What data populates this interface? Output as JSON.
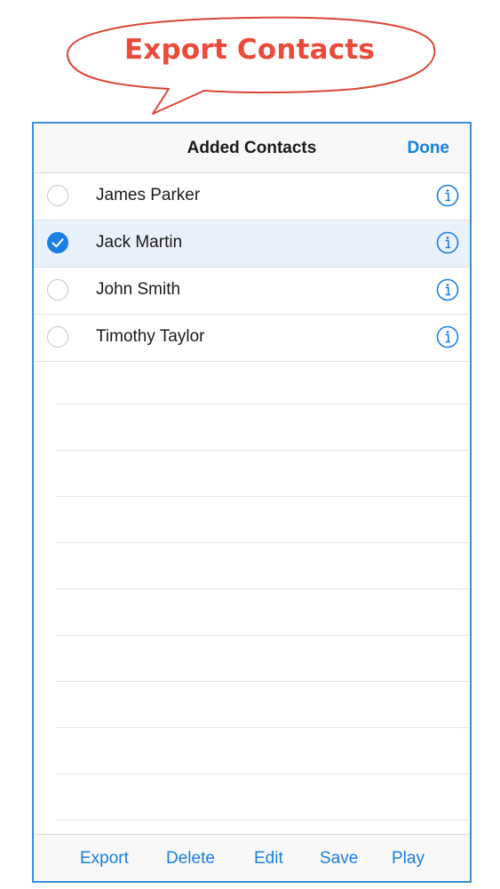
{
  "callout": {
    "text": "Export Contacts",
    "color": "#ea4b3b"
  },
  "navbar": {
    "title": "Added Contacts",
    "done_label": "Done"
  },
  "contacts": [
    {
      "name": "James Parker",
      "selected": false,
      "info_icon": "info-circle-icon"
    },
    {
      "name": "Jack Martin",
      "selected": true,
      "info_icon": "info-circle-icon"
    },
    {
      "name": "John Smith",
      "selected": false,
      "info_icon": "info-circle-icon"
    },
    {
      "name": "Timothy Taylor",
      "selected": false,
      "info_icon": "info-circle-icon"
    }
  ],
  "toolbar": {
    "export_label": "Export",
    "delete_label": "Delete",
    "edit_label": "Edit",
    "save_label": "Save",
    "play_label": "Play"
  },
  "colors": {
    "accent": "#1a7fe0",
    "frame_border": "#3a8fdc",
    "selected_row": "#e9f1fb"
  }
}
